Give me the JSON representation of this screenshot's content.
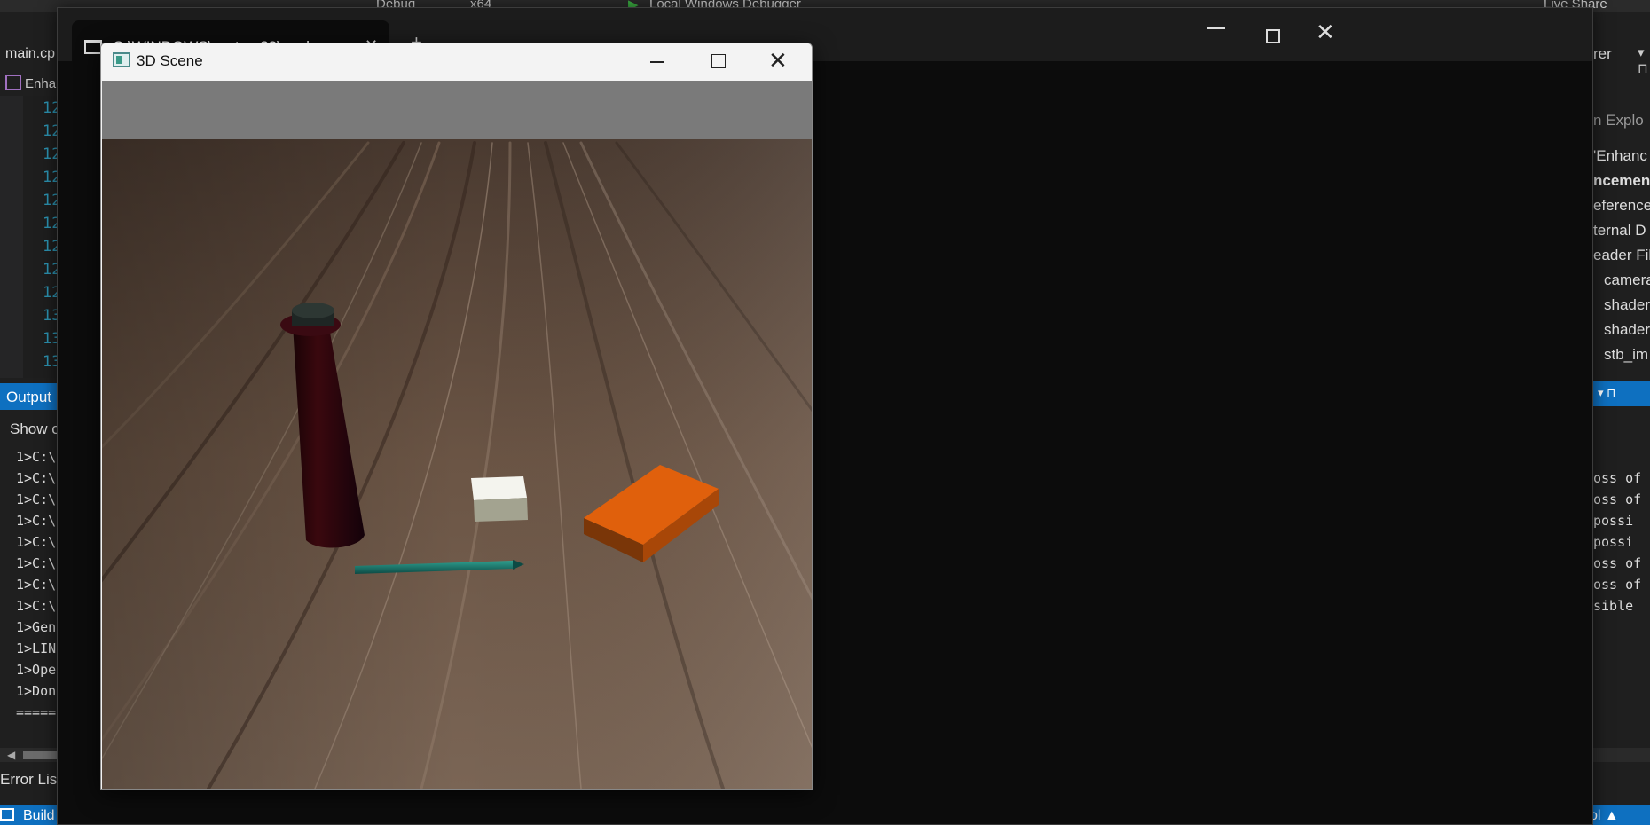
{
  "vs": {
    "toolbar": {
      "config": "Debug",
      "platform": "x64",
      "debugger": "Local Windows Debugger",
      "live_share": "Live Share"
    },
    "doc_tab": "main.cp",
    "nav_project": "Enha",
    "line_numbers": [
      "12",
      "12",
      "12",
      "12",
      "12",
      "12",
      "12",
      "12",
      "12",
      "13",
      "13",
      "13"
    ],
    "output": {
      "header": "Output",
      "show_from": "Show o",
      "lines": [
        "1>C:\\",
        "1>C:\\",
        "1>C:\\",
        "1>C:\\",
        "1>C:\\",
        "1>C:\\",
        "1>C:\\",
        "1>C:\\",
        "1>Gen",
        "1>LIN",
        "1>Ope",
        "1>Don",
        "====="
      ]
    },
    "error_list": "Error List",
    "status_build": "Build",
    "status_right": "ol",
    "right_panel": {
      "tab": "rer",
      "search": "n Explo",
      "nodes": [
        "'Enhanc",
        "ncemen",
        "eferences",
        "ternal D",
        "eader Fil",
        "camera",
        "shader",
        "shader",
        "stb_im"
      ],
      "output_text": [
        "oss of",
        "oss of",
        " possi",
        " possi",
        "oss of",
        "oss of",
        "sible "
      ]
    }
  },
  "console": {
    "tab_title": "C:\\WINDOWS\\system32\\cmd.",
    "new_tab": "+",
    "dropdown": "⌄"
  },
  "scene": {
    "title": "3D Scene",
    "objects": [
      "bottle",
      "white-cube",
      "orange-box",
      "teal-pencil"
    ]
  }
}
